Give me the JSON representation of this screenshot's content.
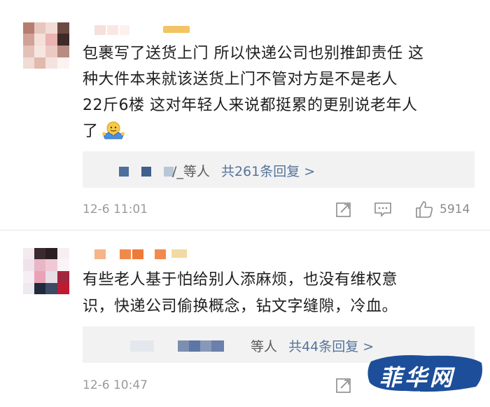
{
  "comments": [
    {
      "text_lines": [
        "包裹写了送货上门 所以快递公司也别推卸责任 这",
        "种大件本来就该送货上门不管对方是不是老人",
        "22斤6楼 这对年轻人来说都挺累的更别说老年人",
        "了"
      ],
      "reply_prefix": "/_等人",
      "reply_count": "共261条回复 >",
      "time": "12-6 11:01",
      "like_count": "5914",
      "emoji": "shrug-emoji"
    },
    {
      "text_lines": [
        "有些老人基于怕给别人添麻烦，也没有维权意",
        "识，快递公司偷换概念，钻文字缝隙，冷血。"
      ],
      "reply_prefix": "等人",
      "reply_count": "共44条回复 >",
      "time": "12-6 10:47"
    }
  ],
  "watermark": {
    "text": "菲华网",
    "color": "#1d4e9a"
  },
  "colors": {
    "reply_link": "#55749a",
    "meta": "#9a9a9a",
    "reply_bg": "#f2f2f2"
  },
  "icons": [
    "share-icon",
    "comment-icon",
    "like-icon"
  ]
}
